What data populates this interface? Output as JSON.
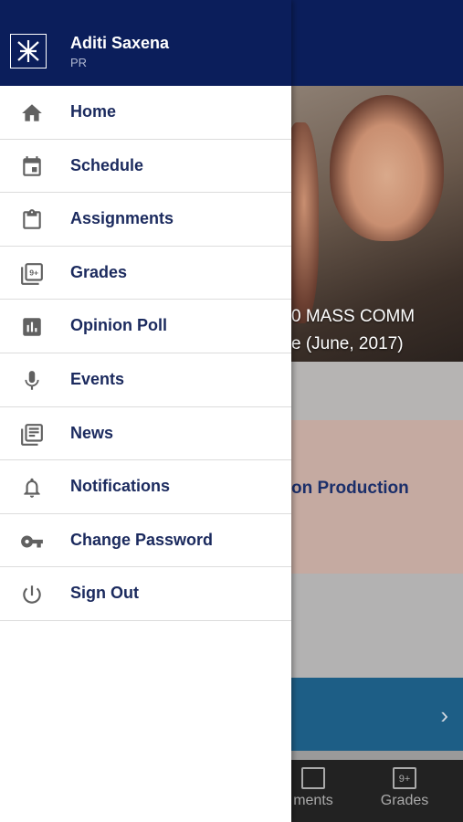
{
  "background": {
    "hero_line1": "0 MASS COMM",
    "hero_line2": "e (June, 2017)",
    "course_title": "on Production",
    "chevron": "›",
    "bottom_nav": {
      "assignments_label": "ments",
      "grades_label": "Grades",
      "grades_icon": "9+"
    }
  },
  "drawer": {
    "logo_icon": "logo-icon",
    "user_name": "Aditi Saxena",
    "user_role": "PR",
    "items": [
      {
        "label": "Home",
        "icon": "home-icon"
      },
      {
        "label": "Schedule",
        "icon": "calendar-icon"
      },
      {
        "label": "Assignments",
        "icon": "clipboard-icon"
      },
      {
        "label": "Grades",
        "icon": "grades-icon"
      },
      {
        "label": "Opinion Poll",
        "icon": "poll-icon"
      },
      {
        "label": "Events",
        "icon": "microphone-icon"
      },
      {
        "label": "News",
        "icon": "news-icon"
      },
      {
        "label": "Notifications",
        "icon": "bell-icon"
      },
      {
        "label": "Change Password",
        "icon": "key-icon"
      },
      {
        "label": "Sign Out",
        "icon": "power-icon"
      }
    ],
    "grades_badge": "9+"
  },
  "colors": {
    "header_bg": "#0b1e5b",
    "label_color": "#1b2a5e",
    "icon_color": "#616161"
  }
}
